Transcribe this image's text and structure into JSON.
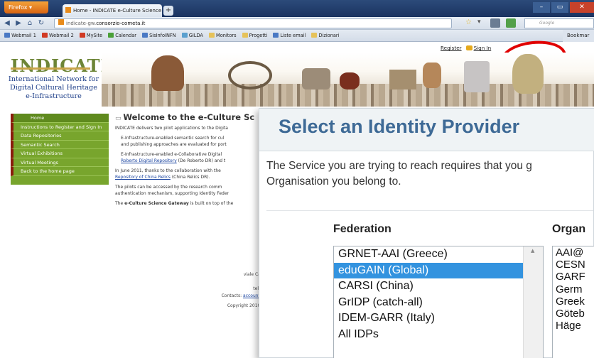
{
  "browser": {
    "app_button": "Firefox",
    "tab_title": "Home - INDICATE e-Culture Science Gat...",
    "new_tab": "+",
    "url_prefix": "indicate-gw.",
    "url_domain": "consorzio-cometa.it",
    "search_placeholder": "Google",
    "bookmarks": [
      {
        "label": "Webmail 1",
        "color": "#4a79c4"
      },
      {
        "label": "Webmail 2",
        "color": "#d13a24"
      },
      {
        "label": "MySite",
        "color": "#d13a24"
      },
      {
        "label": "Calendar",
        "color": "#4aa038"
      },
      {
        "label": "SisInfoINFN",
        "color": "#4a79c4"
      },
      {
        "label": "GILDA",
        "color": "#5aa0cf"
      },
      {
        "label": "Monitors",
        "color": "#e6c25a"
      },
      {
        "label": "Progetti",
        "color": "#e6c25a"
      },
      {
        "label": "Liste email",
        "color": "#4a79c4"
      },
      {
        "label": "Dizionari",
        "color": "#e6c25a"
      }
    ],
    "bookmarks_right": "Bookmar"
  },
  "page": {
    "register_link": "Register",
    "sign_in_link": "Sign In",
    "logo_text": "INDICATE",
    "logo_subtitle": "International Network for Digital Cultural Heritage e-Infrastructure",
    "menu": [
      "Home",
      "Instructions to Register and Sign In",
      "Data Repositories",
      "Semantic Search",
      "Virtual Exhibitions",
      "Virtual Meetings",
      "Back to the home page"
    ],
    "welcome_title": "Welcome to the e-Culture Sc",
    "intro": "INDICATE delivers two pilot applications to the Digita",
    "bullet1_line1": "E-Infrastructure-enabled semantic search for cul",
    "bullet1_line2": "and publishing approaches are evaluated for port",
    "bullet2_line1": "E-Infrastructure-enabled e-Collaborative Digital",
    "bullet2_link": "Roberto Digital Repository",
    "bullet2_rest": " (De Roberto DR) and t",
    "para_june": "In June 2011, thanks to the collaboration with the",
    "china_link": "Repository of China Relics",
    "china_rest": " (China Relics DR).",
    "pilots_line1": "The pilots can be accessed by the research comm",
    "pilots_line2": "authentication mechanism, supporting Identity Feder",
    "built_prefix": "The ",
    "built_bold": "e-Culture Science Gateway",
    "built_rest": " is built on top of the",
    "footer_it": "It",
    "footer_addr": "viale Cas",
    "footer_o": "0",
    "footer_tel": "tel. -",
    "footer_contacts": "Contacts: ",
    "footer_account": "account",
    "footer_copyright": "Copyright 2010 I"
  },
  "idp_dialog": {
    "title": "Select an Identity Provider",
    "text_line1": "The Service you are trying to reach requires that you g",
    "text_line2": "Organisation you belong to.",
    "federation_label": "Federation",
    "organisation_label": "Organ",
    "federations": [
      "GRNET-AAI (Greece)",
      "eduGAIN (Global)",
      "CARSI (China)",
      "GrIDP (catch-all)",
      "IDEM-GARR (Italy)",
      "All IDPs"
    ],
    "selected_federation": "eduGAIN (Global)",
    "organisations": [
      "AAI@",
      "CESN",
      "GARF",
      "Germ",
      "Greek",
      "Göteb",
      "Häge"
    ]
  }
}
